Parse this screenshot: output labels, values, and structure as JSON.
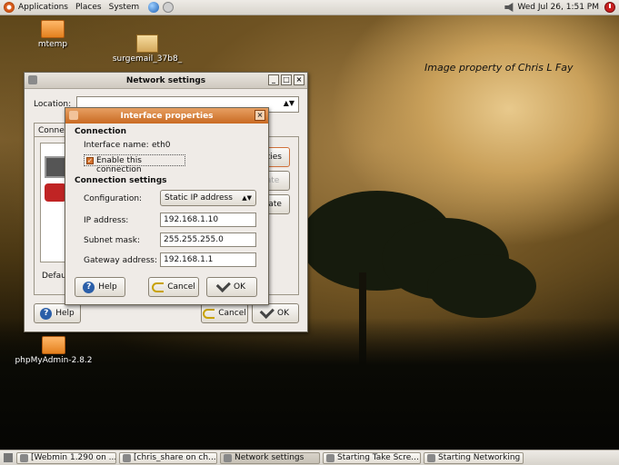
{
  "top_panel": {
    "menus": [
      "Applications",
      "Places",
      "System"
    ],
    "clock": "Wed Jul 26,  1:51 PM"
  },
  "desktop": {
    "icons": [
      "mtemp",
      "surgemail_37b8_",
      "phpMyAdmin-2.8.2"
    ],
    "watermark": "Image property of Chris L Fay"
  },
  "network_settings": {
    "title": "Network settings",
    "location_label": "Location:",
    "tab_label": "Conne",
    "side_buttons": [
      "rties",
      "ate",
      "vate"
    ],
    "default_label": "Defau",
    "help_label": "Help",
    "cancel_label": "Cancel",
    "ok_label": "OK"
  },
  "interface_properties": {
    "title": "Interface properties",
    "connection_heading": "Connection",
    "interface_name_label": "Interface name:",
    "interface_name_value": "eth0",
    "enable_label": "Enable this connection",
    "enable_checked": true,
    "settings_heading": "Connection settings",
    "configuration_label": "Configuration:",
    "configuration_value": "Static IP address",
    "ip_label": "IP address:",
    "ip_value": "192.168.1.10",
    "subnet_label": "Subnet mask:",
    "subnet_value": "255.255.255.0",
    "gateway_label": "Gateway address:",
    "gateway_value": "192.168.1.1",
    "help_label": "Help",
    "cancel_label": "Cancel",
    "ok_label": "OK"
  },
  "taskbar": {
    "tasks": [
      "[Webmin 1.290 on ...",
      "[chris_share on ch...",
      "Network settings",
      "Starting Take Scre...",
      "Starting Networking"
    ],
    "active_index": 2
  },
  "colors": {
    "titlebar_active": "#c96a22",
    "panel": "#e3dfd8"
  }
}
